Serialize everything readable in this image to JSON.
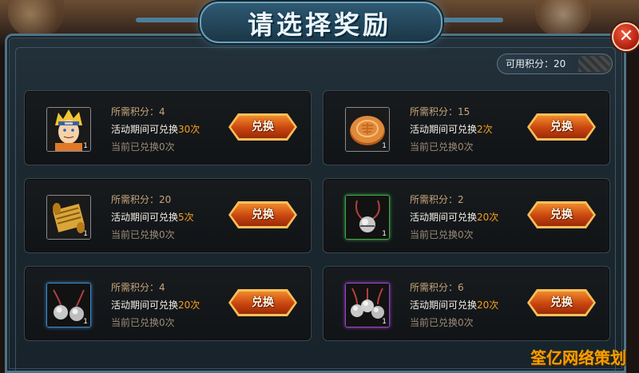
{
  "title": "请选择奖励",
  "close_label": "✕",
  "points_available": "可用积分：20",
  "rewards": [
    {
      "item_name_icon": "character-portrait-icon",
      "item_count": "1",
      "req_prefix": "所需积分：",
      "req_value": "4",
      "limit_prefix": "活动期间可兑换",
      "limit_value": "30次",
      "done_text": "当前已兑换0次",
      "button_label": "兑换"
    },
    {
      "item_name_icon": "mooncake-icon",
      "item_count": "1",
      "req_prefix": "所需积分：",
      "req_value": "15",
      "limit_prefix": "活动期间可兑换",
      "limit_value": "2次",
      "done_text": "当前已兑换0次",
      "button_label": "兑换"
    },
    {
      "item_name_icon": "scroll-icon",
      "item_count": "1",
      "req_prefix": "所需积分：",
      "req_value": "20",
      "limit_prefix": "活动期间可兑换",
      "limit_value": "5次",
      "done_text": "当前已兑换0次",
      "button_label": "兑换"
    },
    {
      "item_name_icon": "bell-icon",
      "item_count": "1",
      "req_prefix": "所需积分：",
      "req_value": "2",
      "limit_prefix": "活动期间可兑换",
      "limit_value": "20次",
      "done_text": "当前已兑换0次",
      "button_label": "兑换"
    },
    {
      "item_name_icon": "double-bell-icon",
      "item_count": "1",
      "req_prefix": "所需积分：",
      "req_value": "4",
      "limit_prefix": "活动期间可兑换",
      "limit_value": "20次",
      "done_text": "当前已兑换0次",
      "button_label": "兑换"
    },
    {
      "item_name_icon": "triple-bell-icon",
      "item_count": "1",
      "req_prefix": "所需积分：",
      "req_value": "6",
      "limit_prefix": "活动期间可兑换",
      "limit_value": "20次",
      "done_text": "当前已兑换0次",
      "button_label": "兑换"
    }
  ],
  "watermark": "筌亿网络策划",
  "colors": {
    "accent_orange": "#f7a11a",
    "button_orange": "#c9450f",
    "frame_blue": "#4f7386"
  }
}
